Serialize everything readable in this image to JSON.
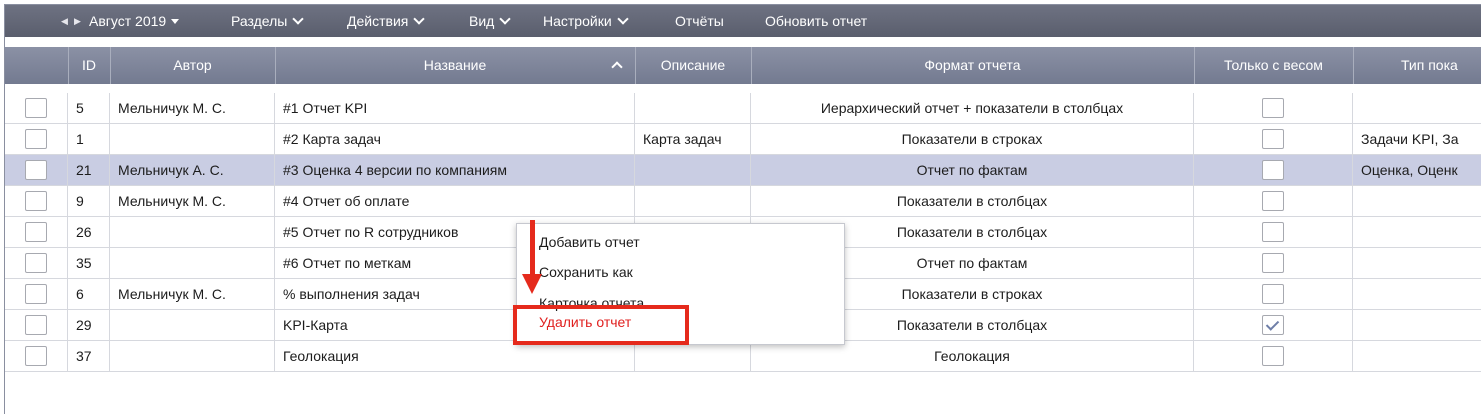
{
  "toolbar": {
    "period": "Август 2019",
    "sections": "Разделы",
    "actions": "Действия",
    "view": "Вид",
    "settings": "Настройки",
    "reports": "Отчёты",
    "refresh": "Обновить отчет"
  },
  "columns": {
    "id": "ID",
    "author": "Автор",
    "name": "Название",
    "description": "Описание",
    "format": "Формат отчета",
    "weighted": "Только с весом",
    "type": "Тип пока"
  },
  "rows": [
    {
      "id": "5",
      "author": "Мельничук М. С.",
      "name": "#1 Отчет KPI",
      "description": "",
      "format": "Иерархический отчет + показатели в столбцах",
      "weighted": false,
      "type": ""
    },
    {
      "id": "1",
      "author": "",
      "name": "#2 Карта задач",
      "description": "Карта задач",
      "format": "Показатели в строках",
      "weighted": false,
      "type": "Задачи KPI, За"
    },
    {
      "id": "21",
      "author": "Мельничук А. С.",
      "name": "#3 Оценка 4 версии по компаниям",
      "description": "",
      "format": "Отчет по фактам",
      "weighted": false,
      "type": "Оценка, Оценк",
      "selected": true
    },
    {
      "id": "9",
      "author": "Мельничук М. С.",
      "name": "#4 Отчет об оплате",
      "description": "",
      "format": "Показатели в столбцах",
      "weighted": false,
      "type": ""
    },
    {
      "id": "26",
      "author": "",
      "name": "#5 Отчет по R сотрудников",
      "description": "",
      "format": "Показатели в столбцах",
      "weighted": false,
      "type": ""
    },
    {
      "id": "35",
      "author": "",
      "name": "#6 Отчет по меткам",
      "description": "",
      "format": "Отчет по фактам",
      "weighted": false,
      "type": ""
    },
    {
      "id": "6",
      "author": "Мельничук М. С.",
      "name": "% выполнения задач",
      "description": "",
      "format": "Показатели в строках",
      "weighted": false,
      "type": ""
    },
    {
      "id": "29",
      "author": "",
      "name": "KPI-Карта",
      "description": "",
      "format": "Показатели в столбцах",
      "weighted": true,
      "type": ""
    },
    {
      "id": "37",
      "author": "",
      "name": "Геолокация",
      "description": "",
      "format": "Геолокация",
      "weighted": false,
      "type": ""
    }
  ],
  "context_menu": {
    "add": "Добавить отчет",
    "save_as": "Сохранить как",
    "card": "Карточка отчета",
    "delete": "Удалить отчет"
  },
  "colors": {
    "toolbar_bg": "#5f6372",
    "header_bg": "#7d8398",
    "selected_row": "#c9cde3",
    "annotation_red": "#e52a1c",
    "danger_text": "#e0201f"
  }
}
